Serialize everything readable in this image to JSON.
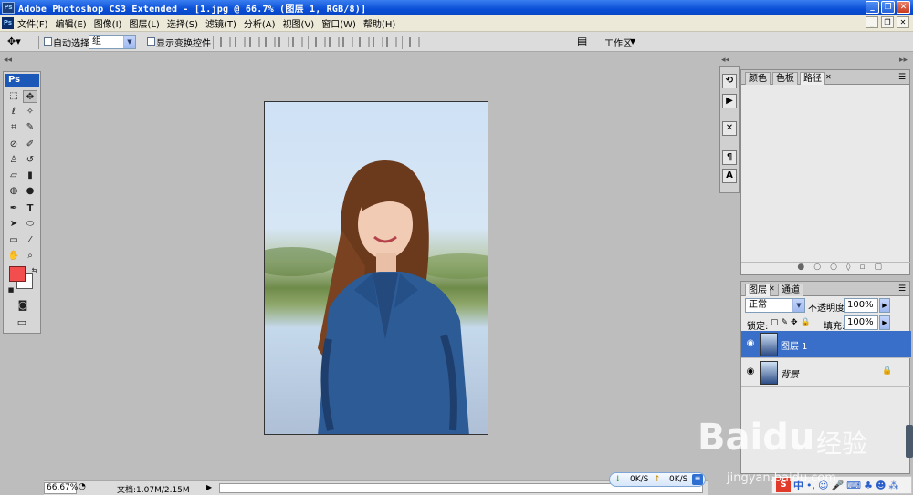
{
  "window": {
    "title": "Adobe Photoshop CS3 Extended - [1.jpg @ 66.7% (图层 1, RGB/8)]",
    "app_icon": "Ps",
    "controls": [
      "minimize",
      "restore",
      "close"
    ]
  },
  "menu": {
    "items": [
      "文件(F)",
      "编辑(E)",
      "图像(I)",
      "图层(L)",
      "选择(S)",
      "滤镜(T)",
      "分析(A)",
      "视图(V)",
      "窗口(W)",
      "帮助(H)"
    ]
  },
  "options": {
    "auto_select_label": "自动选择:",
    "auto_select_value": "组",
    "show_transform_label": "显示变换控件",
    "workspace_label": "工作区"
  },
  "toolbox": {
    "header": "Ps",
    "foreground_color": "#f24e4e",
    "background_color": "#ffffff"
  },
  "status": {
    "zoom": "66.67%",
    "doc_info": "文档:1.07M/2.15M"
  },
  "panels": {
    "top_tabs": [
      "颜色",
      "色板",
      "路径"
    ],
    "layers_tabs": [
      "图层",
      "通道"
    ],
    "blend_mode": "正常",
    "opacity_label": "不透明度:",
    "opacity_value": "100%",
    "lock_label": "锁定:",
    "fill_label": "填充:",
    "fill_value": "100%",
    "layers": [
      {
        "name": "图层 1",
        "selected": true
      },
      {
        "name": "背景",
        "selected": false,
        "locked": true
      }
    ]
  },
  "taskbar": {
    "down_speed": "0K/S",
    "up_speed": "0K/S",
    "ime": "中"
  },
  "watermark": {
    "brand": "Baidu",
    "subtitle": "经验",
    "url": "jingyan.baidu.com"
  },
  "colors": {
    "titlebar": "#0a4fd6",
    "selected_layer": "#3a6fc9",
    "workspace": "#bdbdbd"
  }
}
